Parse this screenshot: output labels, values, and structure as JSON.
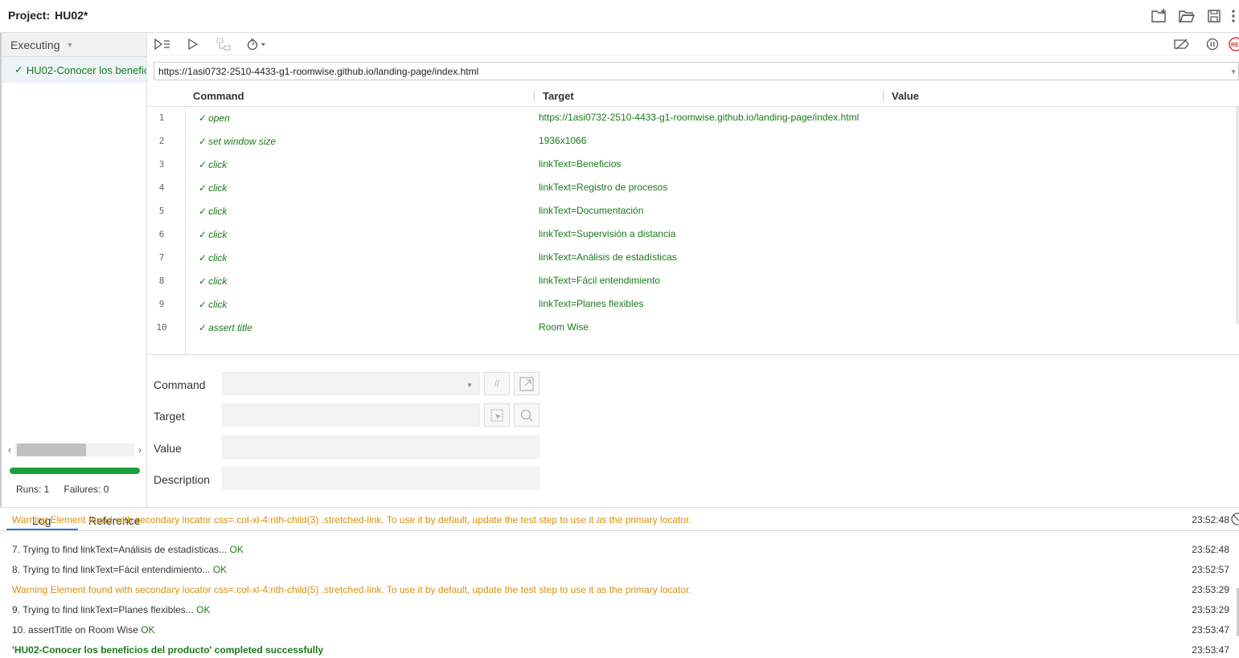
{
  "project": {
    "label": "Project:",
    "name": "HU02*"
  },
  "sidebar": {
    "mode": "Executing",
    "test_name": "HU02-Conocer los beneficios del producto",
    "test_check": "✓",
    "runs_label": "Runs: 1",
    "failures_label": "Failures: 0",
    "progress": 1.0
  },
  "editor": {
    "url": "https://1asi0732-2510-4433-g1-roomwise.github.io/landing-page/index.html",
    "columns": {
      "command": "Command",
      "target": "Target",
      "value": "Value"
    },
    "rows": [
      {
        "num": "1",
        "command": "open",
        "target": "https://1asi0732-2510-4433-g1-roomwise.github.io/landing-page/index.html"
      },
      {
        "num": "2",
        "command": "set window size",
        "target": "1936x1066"
      },
      {
        "num": "3",
        "command": "click",
        "target": "linkText=Beneficios"
      },
      {
        "num": "4",
        "command": "click",
        "target": "linkText=Registro de procesos"
      },
      {
        "num": "5",
        "command": "click",
        "target": "linkText=Documentación"
      },
      {
        "num": "6",
        "command": "click",
        "target": "linkText=Supervisión a distancia"
      },
      {
        "num": "7",
        "command": "click",
        "target": "linkText=Análisis de estadísticas"
      },
      {
        "num": "8",
        "command": "click",
        "target": "linkText=Fácil entendimiento"
      },
      {
        "num": "9",
        "command": "click",
        "target": "linkText=Planes flexibles"
      },
      {
        "num": "10",
        "command": "assert title",
        "target": "Room Wise"
      }
    ],
    "check": "✓"
  },
  "form": {
    "command_label": "Command",
    "target_label": "Target",
    "value_label": "Value",
    "description_label": "Description",
    "comment_btn": "//"
  },
  "log": {
    "tabs": {
      "log": "Log",
      "reference": "Reference"
    },
    "lines": [
      {
        "type": "warn",
        "text": "Warning Element found with secondary locator css=.col-xl-4:nth-child(3) .stretched-link. To use it by default, update the test step to use it as the primary locator.",
        "time": "23:52:48"
      },
      {
        "type": "step",
        "text": "7.   Trying to find linkText=Análisis de estadísticas...",
        "ok": "OK",
        "time": "23:52:48"
      },
      {
        "type": "step",
        "text": "8.   Trying to find linkText=Fácil entendimiento...",
        "ok": "OK",
        "time": "23:52:57"
      },
      {
        "type": "warn",
        "text": "Warning Element found with secondary locator css=.col-xl-4:nth-child(5) .stretched-link. To use it by default, update the test step to use it as the primary locator.",
        "time": "23:53:29"
      },
      {
        "type": "step",
        "text": "9.   Trying to find linkText=Planes flexibles...",
        "ok": "OK",
        "time": "23:53:29"
      },
      {
        "type": "step",
        "text": "10. assertTitle on Room Wise",
        "ok": "OK",
        "time": "23:53:47"
      },
      {
        "type": "success",
        "text": "'HU02-Conocer los beneficios del producto' completed successfully",
        "time": "23:53:47"
      }
    ]
  }
}
